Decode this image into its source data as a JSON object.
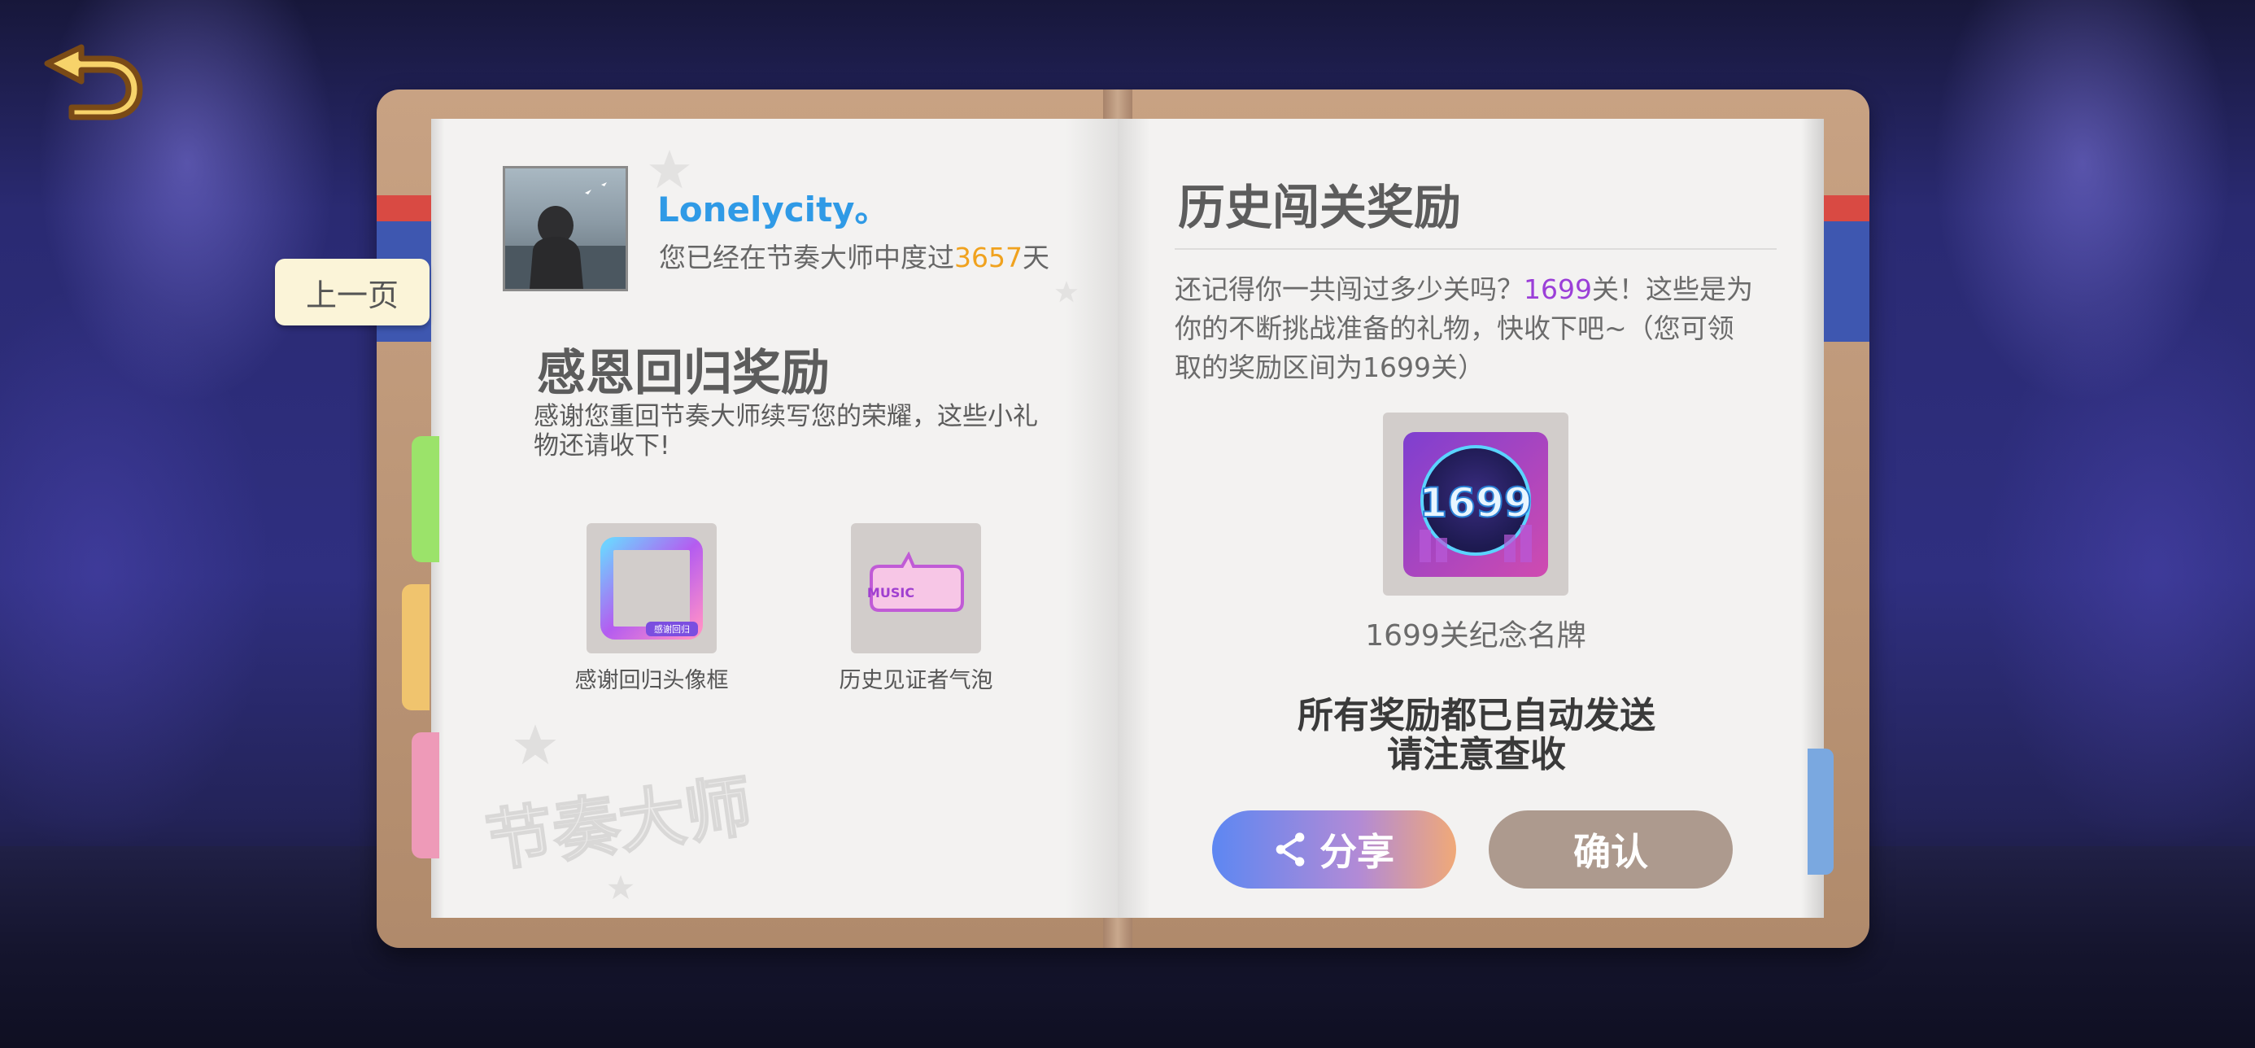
{
  "user": {
    "name": "Lonelycity。",
    "days_prefix": "您已经在节奏大师中度过",
    "days_value": "3657",
    "days_suffix": "天"
  },
  "nav": {
    "prev_page": "上一页"
  },
  "left": {
    "heading": "感恩回归奖励",
    "description": "感谢您重回节奏大师续写您的荣耀，这些小礼物还请收下!",
    "gifts": [
      {
        "label": "感谢回归头像框",
        "badge_text": "感谢回归"
      },
      {
        "label": "历史见证者气泡",
        "badge_text": "MUSIC"
      }
    ],
    "watermark": "节奏大师"
  },
  "right": {
    "heading": "历史闯关奖励",
    "desc_prefix": "还记得你一共闯过多少关吗？",
    "desc_count": "1699",
    "desc_suffix": "关！这些是为你的不断挑战准备的礼物，快收下吧~（您可领取的奖励区间为1699关）",
    "medal_number": "1699",
    "medal_label": "1699关纪念名牌",
    "notice_line1": "所有奖励都已自动发送",
    "notice_line2": "请注意查收"
  },
  "buttons": {
    "share": "分享",
    "confirm": "确认"
  },
  "colors": {
    "username": "#2f9ae6",
    "days_highlight": "#f0a21e",
    "count_highlight": "#9b3fd8",
    "confirm_bg": "#ad9a8e",
    "side_tab_green": "#9be36a",
    "side_tab_orange": "#f0c46e",
    "side_tab_pink": "#ee9ab8",
    "side_tab_blue": "#7aa8e0"
  },
  "icons": [
    "back-arrow-icon",
    "share-icon",
    "star-icon"
  ]
}
